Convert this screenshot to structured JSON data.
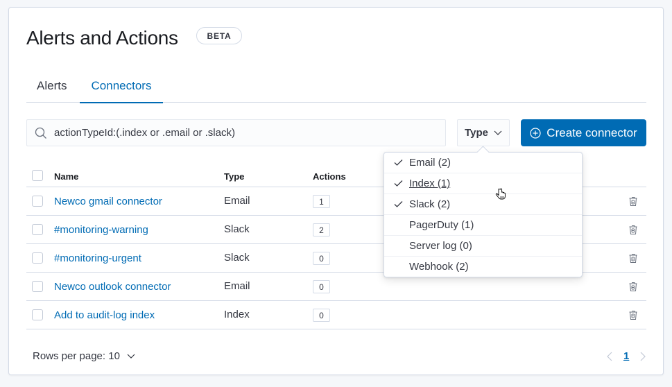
{
  "header": {
    "title": "Alerts and Actions",
    "badge": "BETA"
  },
  "tabs": [
    {
      "label": "Alerts",
      "active": false
    },
    {
      "label": "Connectors",
      "active": true
    }
  ],
  "search": {
    "value": "actionTypeId:(.index or .email or .slack)",
    "icon": "search-icon"
  },
  "type_filter": {
    "label": "Type",
    "icon": "chevron-down-icon"
  },
  "create_button": {
    "label": "Create connector",
    "icon": "plus-circle-icon"
  },
  "colors": {
    "accent": "#006bb4",
    "text": "#343741",
    "border": "#d3dae6"
  },
  "table": {
    "columns": [
      "Name",
      "Type",
      "Actions"
    ],
    "rows": [
      {
        "name": "Newco gmail connector",
        "type": "Email",
        "actions": "1"
      },
      {
        "name": "#monitoring-warning",
        "type": "Slack",
        "actions": "2"
      },
      {
        "name": "#monitoring-urgent",
        "type": "Slack",
        "actions": "0"
      },
      {
        "name": "Newco outlook connector",
        "type": "Email",
        "actions": "0"
      },
      {
        "name": "Add to audit-log index",
        "type": "Index",
        "actions": "0"
      }
    ]
  },
  "type_dropdown": {
    "options": [
      {
        "label": "Email (2)",
        "checked": true
      },
      {
        "label": "Index (1)",
        "checked": true,
        "hovered": true
      },
      {
        "label": "Slack (2)",
        "checked": true
      },
      {
        "label": "PagerDuty (1)",
        "checked": false
      },
      {
        "label": "Server log (0)",
        "checked": false
      },
      {
        "label": "Webhook (2)",
        "checked": false
      }
    ]
  },
  "pagination": {
    "rows_per_page": "Rows per page: 10",
    "current_page": "1"
  }
}
